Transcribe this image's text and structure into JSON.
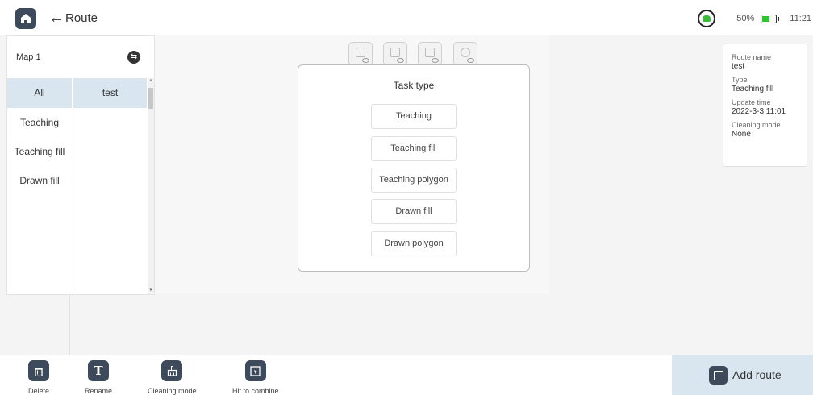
{
  "header": {
    "title": "Route",
    "battery_pct": "50%",
    "battery_level": 0.5,
    "time": "11:21"
  },
  "left_panel": {
    "map_name": "Map 1",
    "types": [
      {
        "label": "All"
      },
      {
        "label": "Teaching"
      },
      {
        "label": "Teaching fill"
      },
      {
        "label": "Drawn fill"
      }
    ],
    "routes": [
      {
        "label": "test"
      }
    ]
  },
  "dialog": {
    "title": "Task type",
    "options": [
      "Teaching",
      "Teaching fill",
      "Teaching polygon",
      "Drawn fill",
      "Drawn polygon"
    ]
  },
  "info": {
    "route_name_label": "Route name",
    "route_name": "test",
    "type_label": "Type",
    "type": "Teaching fill",
    "update_label": "Update time",
    "update": "2022-3-3 11:01",
    "mode_label": "Cleaning mode",
    "mode": "None"
  },
  "actions": {
    "delete": "Delete",
    "rename": "Rename",
    "cleaning_mode": "Cleaning mode",
    "hit_to_combine": "Hit to combine"
  },
  "add_route": {
    "label": "Add route"
  },
  "colors": {
    "accent": "#3d4a5c",
    "selected": "#d9e6ef",
    "battery": "#2ec52e",
    "signal": "#3cba3c"
  }
}
